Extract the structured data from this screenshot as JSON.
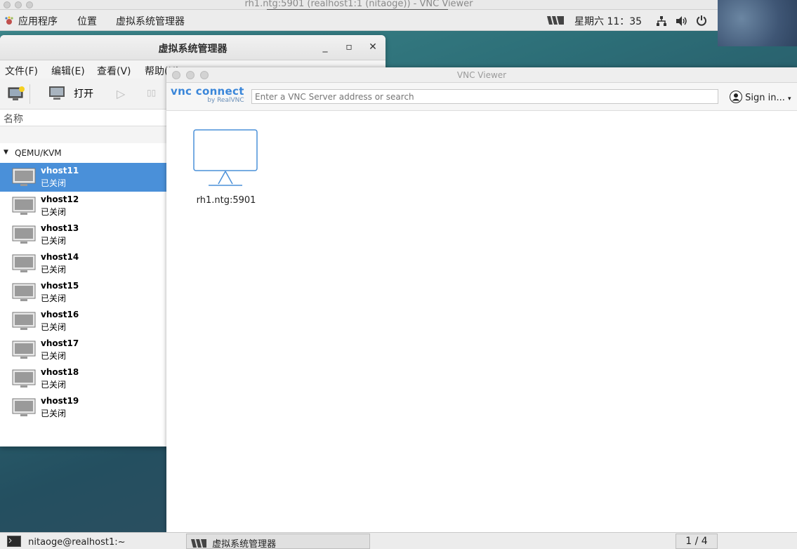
{
  "outer_window": {
    "title": "rh1.ntg:5901 (realhost1:1 (nitaoge)) - VNC Viewer"
  },
  "top_panel": {
    "applications": "应用程序",
    "places": "位置",
    "active_app": "虚拟系统管理器",
    "clock": "星期六 11：35"
  },
  "virt_manager": {
    "title": "虚拟系统管理器",
    "menu": {
      "file": "文件(F)",
      "edit": "编辑(E)",
      "view": "查看(V)",
      "help": "帮助(H)"
    },
    "toolbar": {
      "open": "打开"
    },
    "column_name": "名称",
    "group": "QEMU/KVM",
    "vms": [
      {
        "name": "vhost11",
        "state": "已关闭",
        "selected": true
      },
      {
        "name": "vhost12",
        "state": "已关闭"
      },
      {
        "name": "vhost13",
        "state": "已关闭"
      },
      {
        "name": "vhost14",
        "state": "已关闭"
      },
      {
        "name": "vhost15",
        "state": "已关闭"
      },
      {
        "name": "vhost16",
        "state": "已关闭"
      },
      {
        "name": "vhost17",
        "state": "已关闭"
      },
      {
        "name": "vhost18",
        "state": "已关闭"
      },
      {
        "name": "vhost19",
        "state": "已关闭"
      }
    ]
  },
  "vnc_viewer": {
    "title": "VNC Viewer",
    "logo_main": "vnc connect",
    "logo_sub": "by RealVNC",
    "search_placeholder": "Enter a VNC Server address or search",
    "sign_in": "Sign in...",
    "connections": [
      {
        "label": "rh1.ntg:5901"
      }
    ]
  },
  "taskbar": {
    "terminal": "nitaoge@realhost1:~",
    "virt_manager": "虚拟系统管理器",
    "pager": "1 / 4"
  },
  "colors": {
    "selection": "#4a90d9",
    "vnc_accent": "#3a86d9"
  }
}
